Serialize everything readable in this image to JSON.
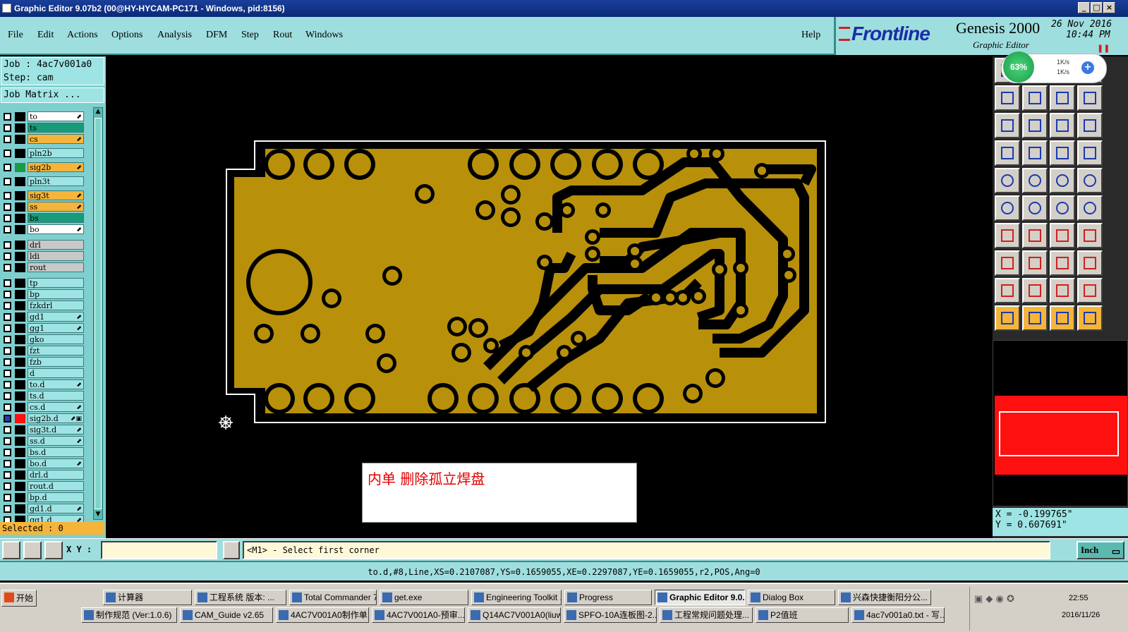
{
  "window": {
    "title": "Graphic Editor 9.07b2 (00@HY-HYCAM-PC171 - Windows, pid:8156)"
  },
  "menu": [
    "File",
    "Edit",
    "Actions",
    "Options",
    "Analysis",
    "DFM",
    "Step",
    "Rout",
    "Windows"
  ],
  "help": "Help",
  "logo": {
    "brand": "Frontline",
    "product": "Genesis 2000",
    "subtitle": "Graphic Editor",
    "date": "26 Nov 2016",
    "time": "10:44 PM"
  },
  "job": {
    "job_label": "Job : 4ac7v001a0",
    "step_label": "Step: cam",
    "matrix_button": "Job Matrix ..."
  },
  "layers": [
    {
      "name": "to",
      "bg": "#ffffff",
      "mark": "⬈"
    },
    {
      "name": "ts",
      "bg": "#1a9a7a",
      "mark": ""
    },
    {
      "name": "cs",
      "bg": "#f5b53a",
      "mark": "⬈"
    },
    {
      "name": "pln2b",
      "bg": "#9fe4e4",
      "mark": ""
    },
    {
      "name": "sig2b",
      "bg": "#f5b53a",
      "mark": "⬈"
    },
    {
      "name": "pln3t",
      "bg": "#9fe4e4",
      "mark": ""
    },
    {
      "name": "sig3t",
      "bg": "#f5b53a",
      "mark": "⬈"
    },
    {
      "name": "ss",
      "bg": "#f5b53a",
      "mark": "⬈"
    },
    {
      "name": "bs",
      "bg": "#1a9a7a",
      "mark": ""
    },
    {
      "name": "bo",
      "bg": "#ffffff",
      "mark": "⬈"
    },
    {
      "name": "drl",
      "bg": "#c8c8c8",
      "mark": ""
    },
    {
      "name": "ldi",
      "bg": "#c8c8c8",
      "mark": ""
    },
    {
      "name": "rout",
      "bg": "#c8c8c8",
      "mark": ""
    },
    {
      "name": "tp",
      "bg": "#9fe4e4",
      "mark": ""
    },
    {
      "name": "bp",
      "bg": "#9fe4e4",
      "mark": ""
    },
    {
      "name": "fzkdrl",
      "bg": "#9fe4e4",
      "mark": ""
    },
    {
      "name": "gd1",
      "bg": "#9fe4e4",
      "mark": "⬈"
    },
    {
      "name": "gg1",
      "bg": "#9fe4e4",
      "mark": "⬈"
    },
    {
      "name": "gko",
      "bg": "#9fe4e4",
      "mark": ""
    },
    {
      "name": "fzt",
      "bg": "#9fe4e4",
      "mark": ""
    },
    {
      "name": "fzb",
      "bg": "#9fe4e4",
      "mark": ""
    },
    {
      "name": "d",
      "bg": "#9fe4e4",
      "mark": ""
    },
    {
      "name": "to.d",
      "bg": "#9fe4e4",
      "mark": "⬈"
    },
    {
      "name": "ts.d",
      "bg": "#9fe4e4",
      "mark": ""
    },
    {
      "name": "cs.d",
      "bg": "#9fe4e4",
      "mark": "⬈"
    },
    {
      "name": "sig2b.d",
      "bg": "#9fe4e4",
      "mark": "⬈▣"
    },
    {
      "name": "sig3t.d",
      "bg": "#9fe4e4",
      "mark": "⬈"
    },
    {
      "name": "ss.d",
      "bg": "#9fe4e4",
      "mark": "⬈"
    },
    {
      "name": "bs.d",
      "bg": "#9fe4e4",
      "mark": ""
    },
    {
      "name": "bo.d",
      "bg": "#9fe4e4",
      "mark": "⬈"
    },
    {
      "name": "drl.d",
      "bg": "#9fe4e4",
      "mark": ""
    },
    {
      "name": "rout.d",
      "bg": "#9fe4e4",
      "mark": ""
    },
    {
      "name": "bp.d",
      "bg": "#9fe4e4",
      "mark": ""
    },
    {
      "name": "gd1.d",
      "bg": "#9fe4e4",
      "mark": "⬈"
    },
    {
      "name": "gg1.d",
      "bg": "#9fe4e4",
      "mark": "⬈"
    }
  ],
  "selected": "Selected : 0",
  "annotation": "内单 删除孤立焊盘",
  "coords": {
    "x": "X = -0.199765\"",
    "y": "Y = 0.607691\""
  },
  "speed": {
    "percent": "63%",
    "up": "1K/s",
    "down": "1K/s"
  },
  "command": {
    "xy_label": "X Y :",
    "xy_value": "",
    "prompt": "<M1> - Select first corner",
    "units": "Inch"
  },
  "status": "to.d,#8,Line,XS=0.2107087,YS=0.1659055,XE=0.2297087,YE=0.1659055,r2,POS,Ang=0",
  "taskbar": {
    "start": "开始",
    "row1": [
      "计算器",
      "工程系统  版本: ...",
      "Total Commander 7...",
      "get.exe",
      "Engineering Toolkit ...",
      "Progress",
      "Graphic Editor 9.0...",
      "Dialog Box",
      "兴森快捷衡阳分公..."
    ],
    "row2": [
      "制作规范 (Ver:1.0.6)",
      "CAM_Guide v2.65",
      "4AC7V001A0制作单...",
      "4AC7V001A0-预审...",
      "Q14AC7V001A0(liuw...",
      "SPFO-10A连板图-2...",
      "工程常规问题处理...",
      "P2值班",
      "4ac7v001a0.txt - 写..."
    ],
    "clock_time": "22:55",
    "clock_date": "2016/11/26"
  },
  "colors": {
    "copper": "#b8900a",
    "board_bg": "#ffffff",
    "panel": "#9fdede"
  }
}
